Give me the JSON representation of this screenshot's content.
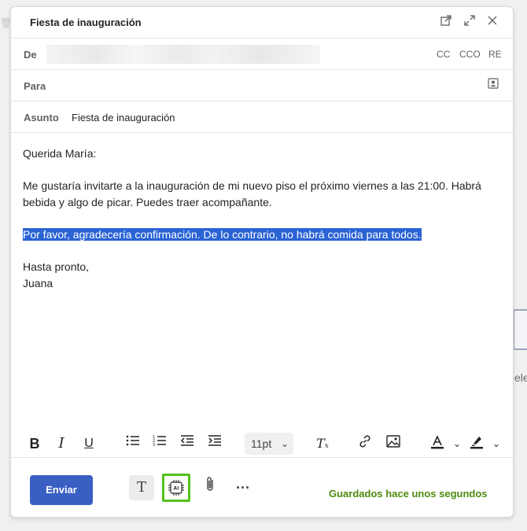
{
  "window": {
    "title": "Fiesta de inauguración"
  },
  "from": {
    "label": "De",
    "cc": "CC",
    "cco": "CCO",
    "re": "RE"
  },
  "to": {
    "label": "Para"
  },
  "subject": {
    "label": "Asunto",
    "value": "Fiesta de inauguración"
  },
  "body": {
    "greeting": "Querida María:",
    "paragraph": "Me gustaría invitarte a la inauguración de mi nuevo piso el próximo viernes a las 21:00. Habrá bebida y algo de picar. Puedes traer acompañante.",
    "highlighted": "Por favor, agradecería confirmación. De lo contrario, no habrá comida para todos.",
    "closing": "Hasta pronto,",
    "signature": "Juana"
  },
  "format": {
    "font_size": "11pt"
  },
  "footer": {
    "send_label": "Enviar",
    "status": "Guardados hace unos segundos"
  },
  "background": {
    "partial_text": "ele"
  },
  "colors": {
    "accent": "#3a5fc3",
    "highlight": "#2a63d4",
    "status": "#4f8a10",
    "ai_border": "#54c21b"
  }
}
